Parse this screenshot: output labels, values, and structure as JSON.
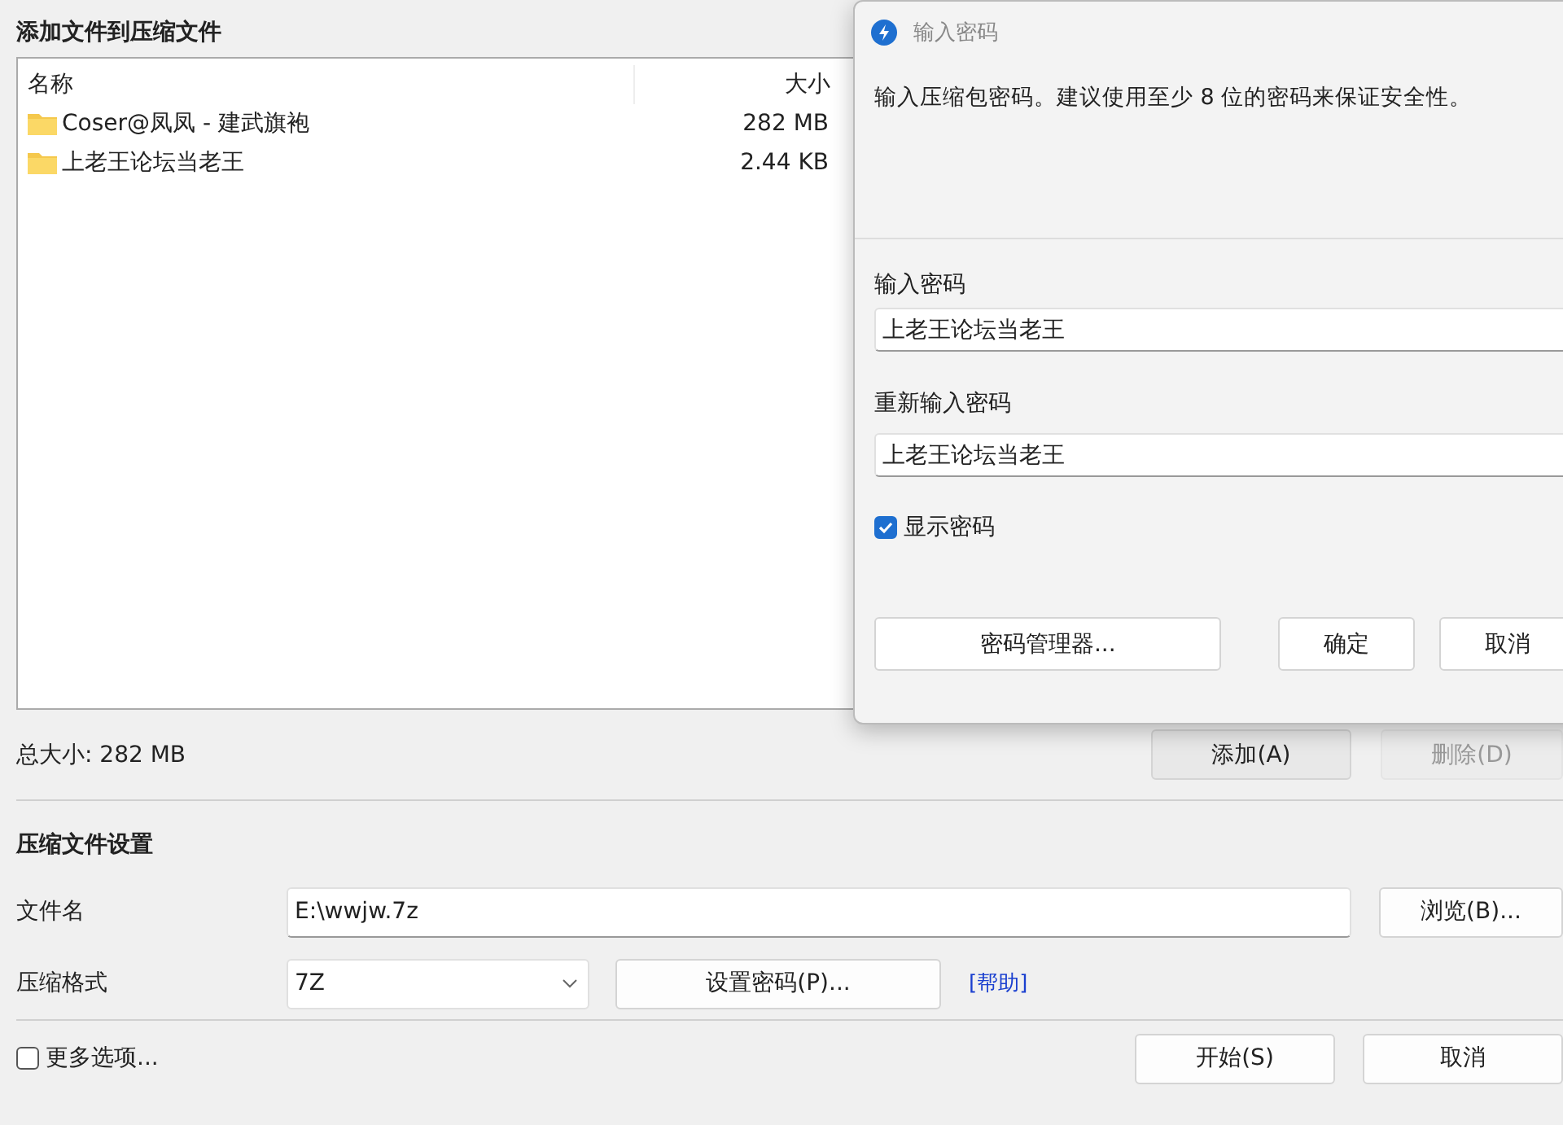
{
  "window": {
    "title": "添加文件到压缩文件"
  },
  "file_list": {
    "columns": [
      "名称",
      "大小"
    ],
    "rows": [
      {
        "name": "Coser@凤凤 - 建武旗袍",
        "size": "282 MB"
      },
      {
        "name": "上老王论坛当老王",
        "size": "2.44 KB"
      }
    ]
  },
  "total_size": "总大小: 282 MB",
  "list_buttons": [
    {
      "label": "添加(A)",
      "disabled": false
    },
    {
      "label": "删除(D)",
      "disabled": true
    }
  ],
  "settings": {
    "title": "压缩文件设置",
    "filename_label": "文件名",
    "filename": "E:\\wwjw.7z",
    "browse": "浏览(B)...",
    "format_label": "压缩格式",
    "format": "7Z",
    "set_password": "设置密码(P)...",
    "help": "[帮助]"
  },
  "more_options": {
    "label": "更多选项...",
    "checked": false
  },
  "bottom_buttons": [
    "开始(S)",
    "取消"
  ],
  "dialog": {
    "title": "输入密码",
    "message": "输入压缩包密码。建议使用至少 8 位的密码来保证安全性。",
    "password_label": "输入密码",
    "password": "上老王论坛当老王",
    "repeat_label": "重新输入密码",
    "repeat": "上老王论坛当老王",
    "show_password": {
      "label": "显示密码",
      "checked": true
    },
    "buttons": [
      "密码管理器...",
      "确定",
      "取消"
    ]
  }
}
